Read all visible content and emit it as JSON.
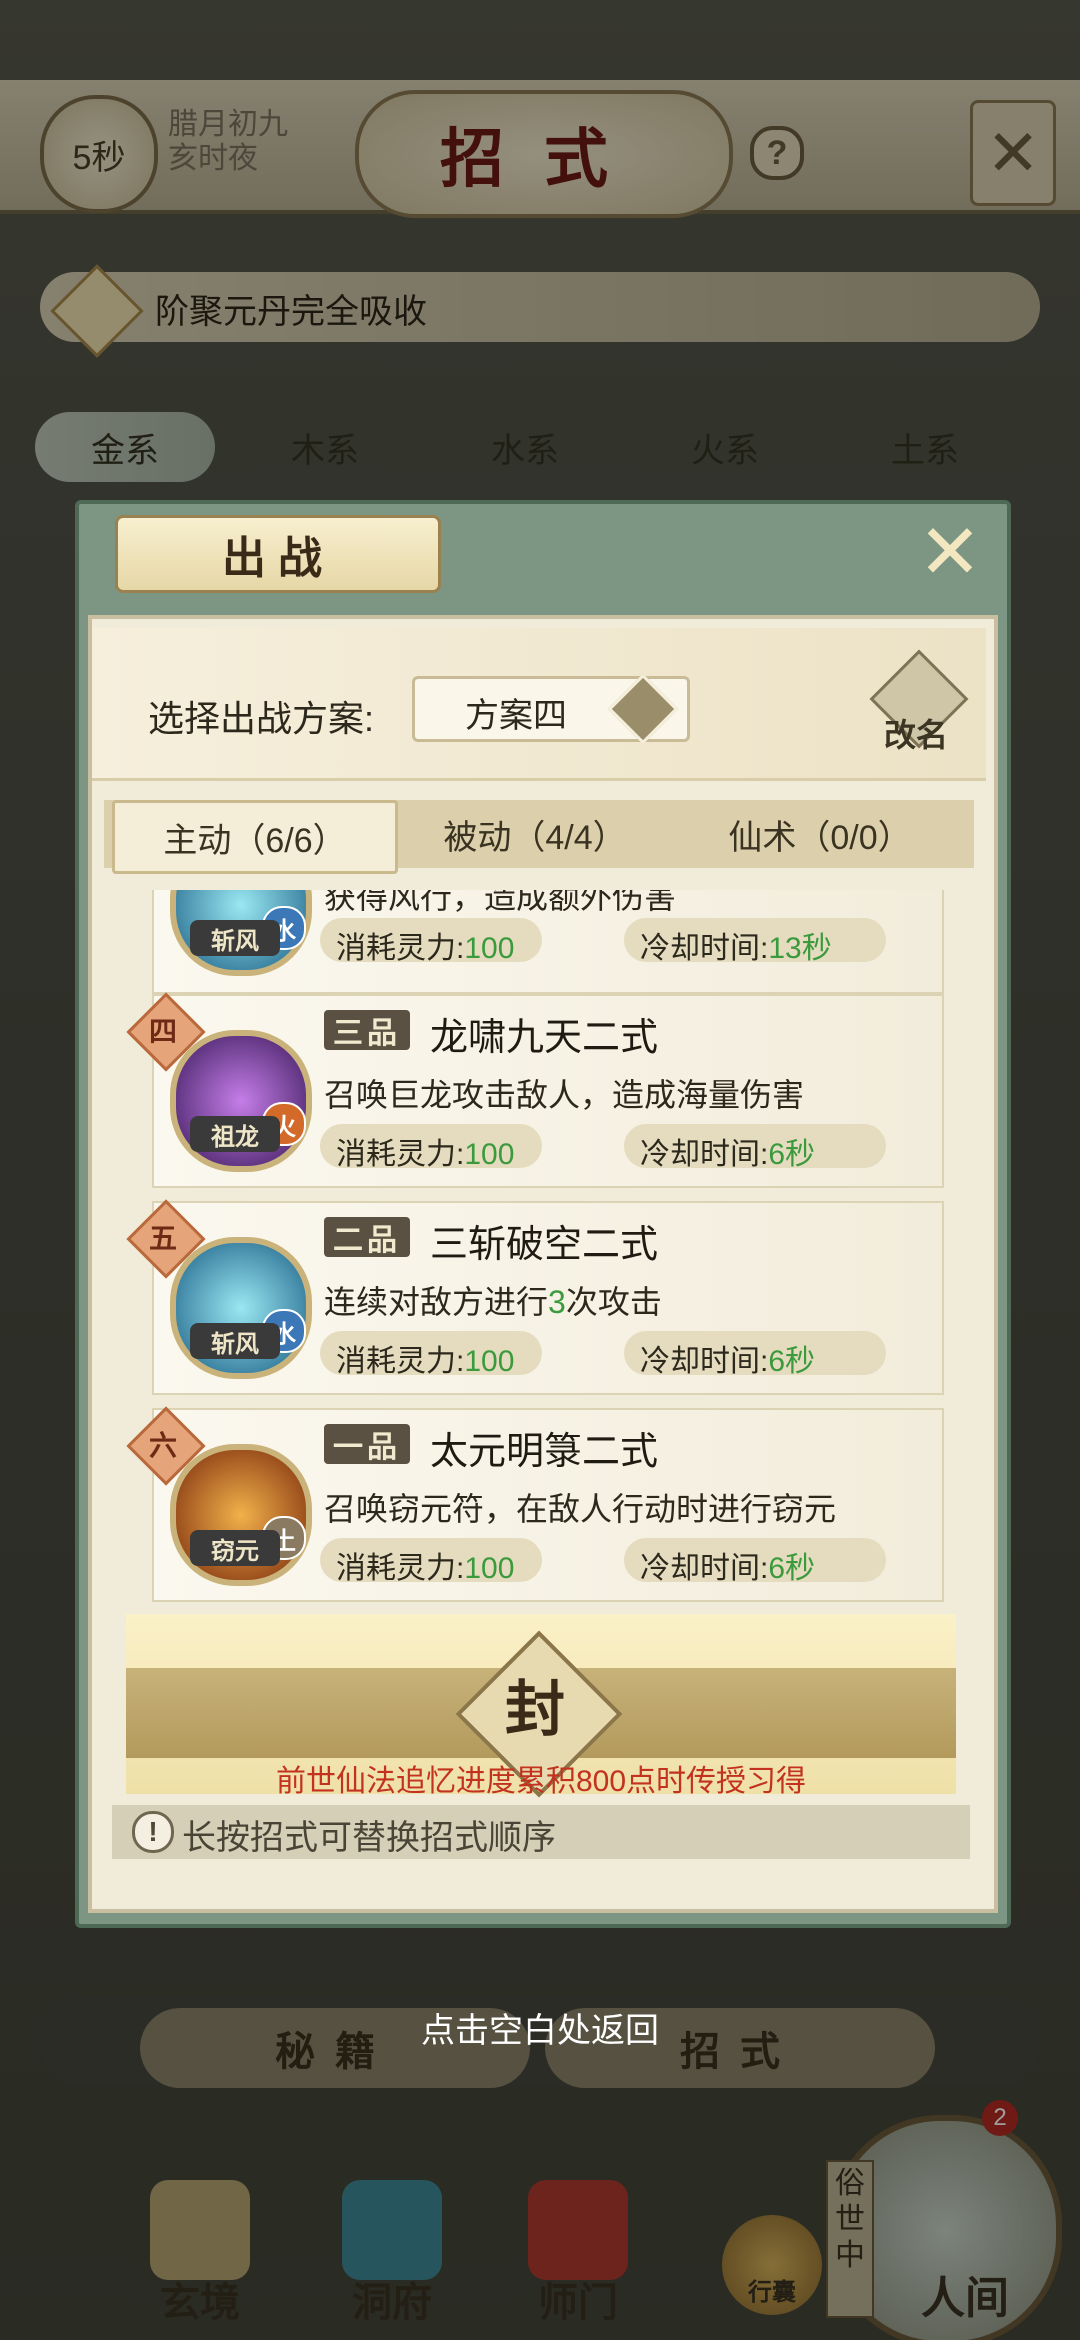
{
  "top": {
    "timer": "5秒",
    "lunar_date": "腊月初九",
    "lunar_time": "亥时夜",
    "title": "招式",
    "help": "?"
  },
  "notice": {
    "text": "阶聚元丹完全吸收"
  },
  "element_tabs": [
    "金系",
    "木系",
    "水系",
    "火系",
    "土系"
  ],
  "modal": {
    "title": "出战",
    "plan_label": "选择出战方案:",
    "plan_value": "方案四",
    "rename_label": "改名",
    "tabs": [
      "主动（6/6）",
      "被动（4/4）",
      "仙术（0/0）"
    ],
    "stat_cost_label": "消耗灵力:",
    "stat_cd_label": "冷却时间:",
    "skills": [
      {
        "icon_label": "斩风",
        "element": "水",
        "desc": "获得风行，造成额外伤害",
        "cost": "100",
        "cooldown": "13秒"
      },
      {
        "number": "四",
        "rank": "三品",
        "name": "龙啸九天二式",
        "icon_label": "祖龙",
        "element": "火",
        "desc": "召唤巨龙攻击敌人，造成海量伤害",
        "cost": "100",
        "cooldown": "6秒"
      },
      {
        "number": "五",
        "rank": "二品",
        "name": "三斩破空二式",
        "icon_label": "斩风",
        "element": "水",
        "desc_pre": "连续对敌方进行",
        "desc_hl": "3",
        "desc_post": "次攻击",
        "cost": "100",
        "cooldown": "6秒"
      },
      {
        "number": "六",
        "rank": "一品",
        "name": "太元明箓二式",
        "icon_label": "窃元",
        "element": "土",
        "desc": "召唤窃元符，在敌人行动时进行窃元",
        "cost": "100",
        "cooldown": "6秒"
      }
    ],
    "sealed_char": "封",
    "sealed_text": "前世仙法追忆进度累积800点时传授习得",
    "hint": "长按招式可替换招式顺序"
  },
  "bottom": {
    "back_hint": "点击空白处返回",
    "tab_left": "秘籍",
    "tab_right": "招式",
    "nav": [
      "玄境",
      "洞府",
      "师门"
    ],
    "bag": "行囊",
    "world_tag": "俗世中",
    "world_label": "人间",
    "badge": "2"
  },
  "colors": {
    "accent_red": "#6e1a14",
    "value_green": "#3a9a3c",
    "warning_red": "#c2321e",
    "modal_green": "#7d9683"
  }
}
